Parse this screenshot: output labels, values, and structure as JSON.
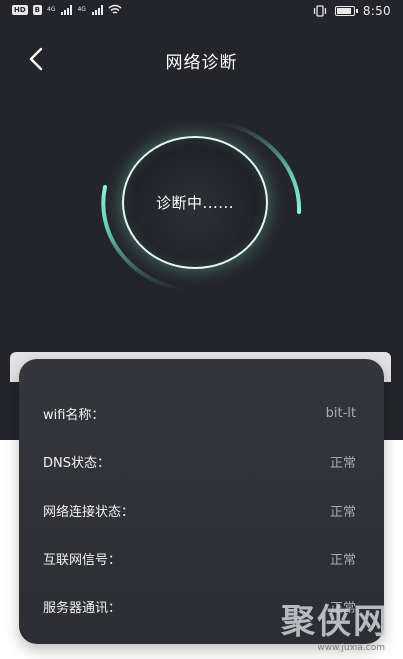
{
  "status_bar": {
    "hd_badge": "HD",
    "hd_sub": "B",
    "net1": "4G",
    "net2": "4G",
    "time": "8:50",
    "icons": [
      "vibrate-icon",
      "battery-icon",
      "wifi-icon",
      "signal-icon"
    ]
  },
  "header": {
    "title": "网络诊断",
    "back_icon": "chevron-left-icon"
  },
  "diagnosis": {
    "status_text": "诊断中......"
  },
  "info": {
    "rows": [
      {
        "label": "wifi名称：",
        "value": "bit-lt"
      },
      {
        "label": "DNS状态：",
        "value": "正常"
      },
      {
        "label": "网络连接状态：",
        "value": "正常"
      },
      {
        "label": "互联网信号：",
        "value": "正常"
      },
      {
        "label": "服务器通讯：",
        "value": "正常"
      }
    ]
  },
  "watermark": {
    "text": "聚侠网",
    "url": "www.juxia.com"
  },
  "colors": {
    "background_dark": "#24252a",
    "card": "#2f3137",
    "accent_teal": "#6fe0c2",
    "value_gray": "#a9abb0"
  }
}
